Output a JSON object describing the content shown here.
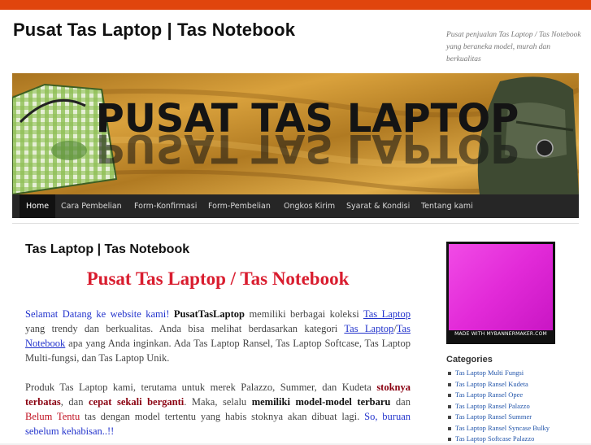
{
  "site": {
    "title": "Pusat Tas Laptop | Tas Notebook",
    "description": "Pusat penjualan Tas Laptop / Tas Notebook yang beraneka model, murah dan berkualitas"
  },
  "banner": {
    "text": "PUSAT TAS LAPTOP"
  },
  "nav": {
    "items": [
      "Home",
      "Cara Pembelian",
      "Form-Konfirmasi",
      "Form-Pembelian",
      "Ongkos Kirim",
      "Syarat & Kondisi",
      "Tentang kami"
    ]
  },
  "post": {
    "title": "Tas Laptop | Tas Notebook",
    "headline": "Pusat Tas Laptop / Tas Notebook",
    "p1": {
      "welcome": "Selamat Datang ke website kami!",
      "brand": "PusatTasLaptop",
      "t1": " memiliki berbagai koleksi ",
      "link1": "Tas Laptop",
      "t2": " yang trendy dan berkualitas. Anda bisa melihat berdasarkan kategori ",
      "link2": "Tas Laptop",
      "slash": "/",
      "link3": "Tas Notebook",
      "t3": " apa yang Anda inginkan. Ada Tas Laptop Ransel, Tas Laptop Softcase, Tas Laptop Multi-fungsi, dan Tas Laptop Unik."
    },
    "p2": {
      "t1": "Produk Tas Laptop kami, terutama untuk merek Palazzo, Summer, dan Kudeta ",
      "stock": "stoknya terbatas",
      "t2": ", dan ",
      "fast": "cepat sekali berganti",
      "t3": ". Maka, selalu ",
      "models": "memiliki model-model terbaru",
      "t4": " dan ",
      "maybe": "Belum Tentu",
      "t5": " tas dengan model tertentu yang habis stoknya akan dibuat lagi. ",
      "so": "So,",
      "t6": " ",
      "hurry": "buruan sebelum kehabisan..!!"
    }
  },
  "sidebar": {
    "ad_text": "MADE WITH MYBANNERMAKER.COM",
    "categories_title": "Categories",
    "categories": [
      "Tas Laptop Multi Fungsi",
      "Tas Laptop Ransel Kudeta",
      "Tas Laptop Ransel Opee",
      "Tas Laptop Ransel Palazzo",
      "Tas Laptop Ransel Summer",
      "Tas Laptop Ransel Syncase Bulky",
      "Tas Laptop Softcase Palazzo"
    ]
  },
  "colors": {
    "accent": "#e0450d",
    "nav_bg": "#262626",
    "headline": "#d91d2f",
    "link": "#2233cc"
  }
}
